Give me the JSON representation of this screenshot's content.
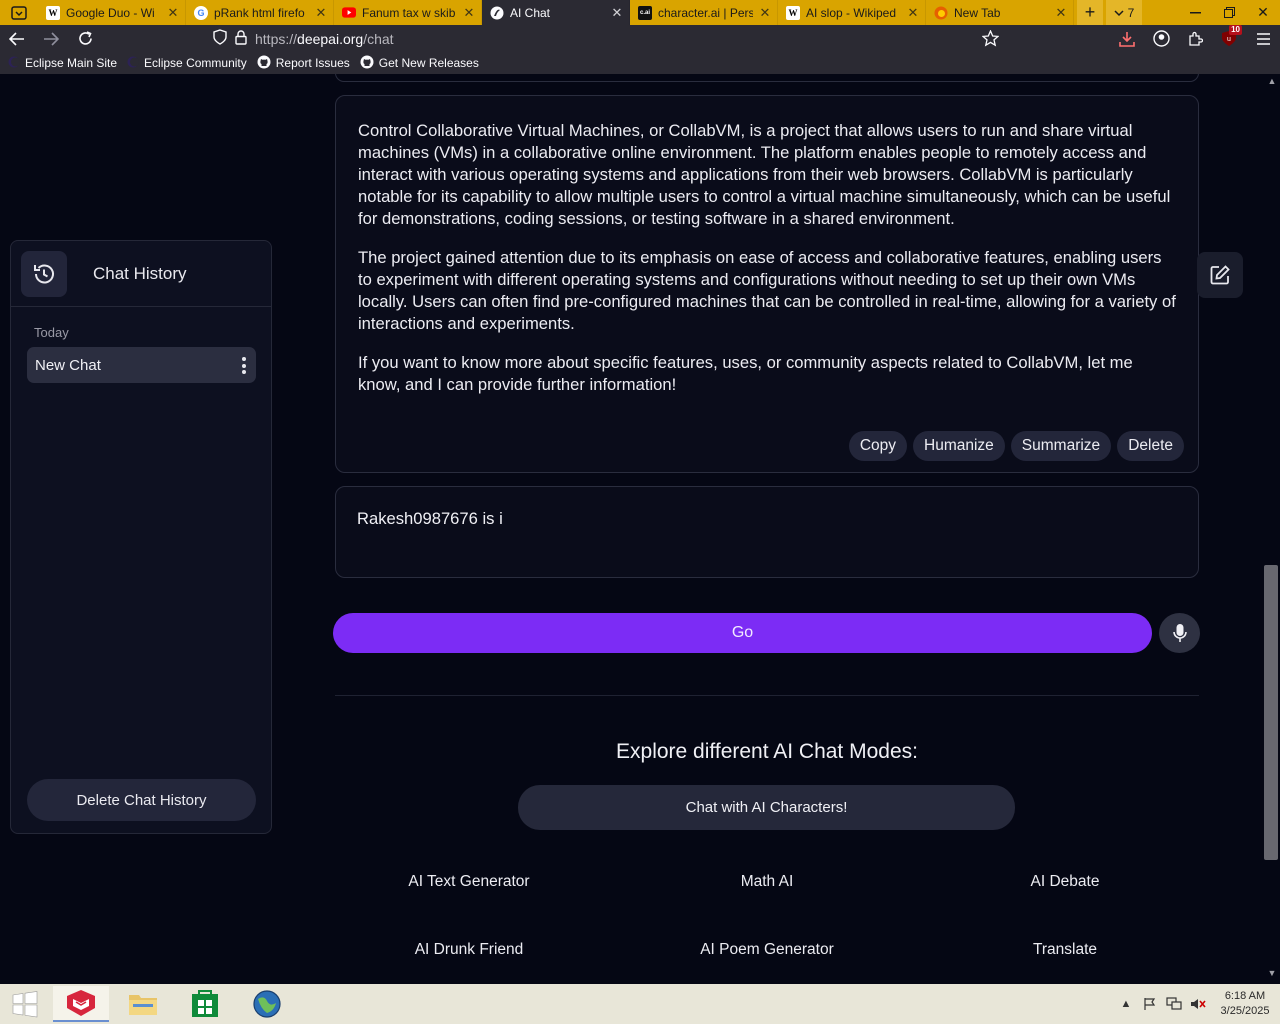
{
  "browser": {
    "tabs": [
      {
        "title": "Google Duo - Wi",
        "favicon": "W",
        "active": false
      },
      {
        "title": "pRank html firefo",
        "favicon": "G",
        "active": false
      },
      {
        "title": "Fanum tax w skib",
        "favicon": "youtube",
        "active": false
      },
      {
        "title": "AI Chat",
        "favicon": "deepai",
        "active": true
      },
      {
        "title": "character.ai | Pers",
        "favicon": "c.ai",
        "active": false
      },
      {
        "title": "AI slop - Wikiped",
        "favicon": "W",
        "active": false
      },
      {
        "title": "New Tab",
        "favicon": "firefox",
        "active": false
      }
    ],
    "tab_count": "7",
    "url_scheme": "https://",
    "url_host": "deepai.org",
    "url_path": "/chat",
    "extension_badge": "10",
    "bookmarks": [
      {
        "label": "Eclipse Main Site",
        "icon": "eclipse-icon"
      },
      {
        "label": "Eclipse Community",
        "icon": "eclipse-icon"
      },
      {
        "label": "Report Issues",
        "icon": "github-icon"
      },
      {
        "label": "Get New Releases",
        "icon": "github-icon"
      }
    ]
  },
  "sidebar": {
    "title": "Chat History",
    "section_label": "Today",
    "items": [
      {
        "label": "New Chat"
      }
    ],
    "delete_label": "Delete Chat History"
  },
  "message": {
    "paragraphs": [
      "Control Collaborative Virtual Machines, or CollabVM, is a project that allows users to run and share virtual machines (VMs) in a collaborative online environment. The platform enables people to remotely access and interact with various operating systems and applications from their web browsers. CollabVM is particularly notable for its capability to allow multiple users to control a virtual machine simultaneously, which can be useful for demonstrations, coding sessions, or testing software in a shared environment.",
      "The project gained attention due to its emphasis on ease of access and collaborative features, enabling users to experiment with different operating systems and configurations without needing to set up their own VMs locally. Users can often find pre-configured machines that can be controlled in real-time, allowing for a variety of interactions and experiments.",
      "If you want to know more about specific features, uses, or community aspects related to CollabVM, let me know, and I can provide further information!"
    ],
    "actions": {
      "copy": "Copy",
      "humanize": "Humanize",
      "summarize": "Summarize",
      "delete": "Delete"
    }
  },
  "input": {
    "value": "Rakesh0987676 is i"
  },
  "go_label": "Go",
  "explore": {
    "title": "Explore different AI Chat Modes:",
    "characters_label": "Chat with AI Characters!",
    "modes": [
      "AI Text Generator",
      "Math AI",
      "AI Debate",
      "AI Drunk Friend",
      "AI Poem Generator",
      "Translate"
    ]
  },
  "taskbar": {
    "time": "6:18 AM",
    "date": "3/25/2025"
  },
  "colors": {
    "accent": "#7c2cf5",
    "page_bg": "#050714",
    "tab_strip": "#d9a400"
  }
}
